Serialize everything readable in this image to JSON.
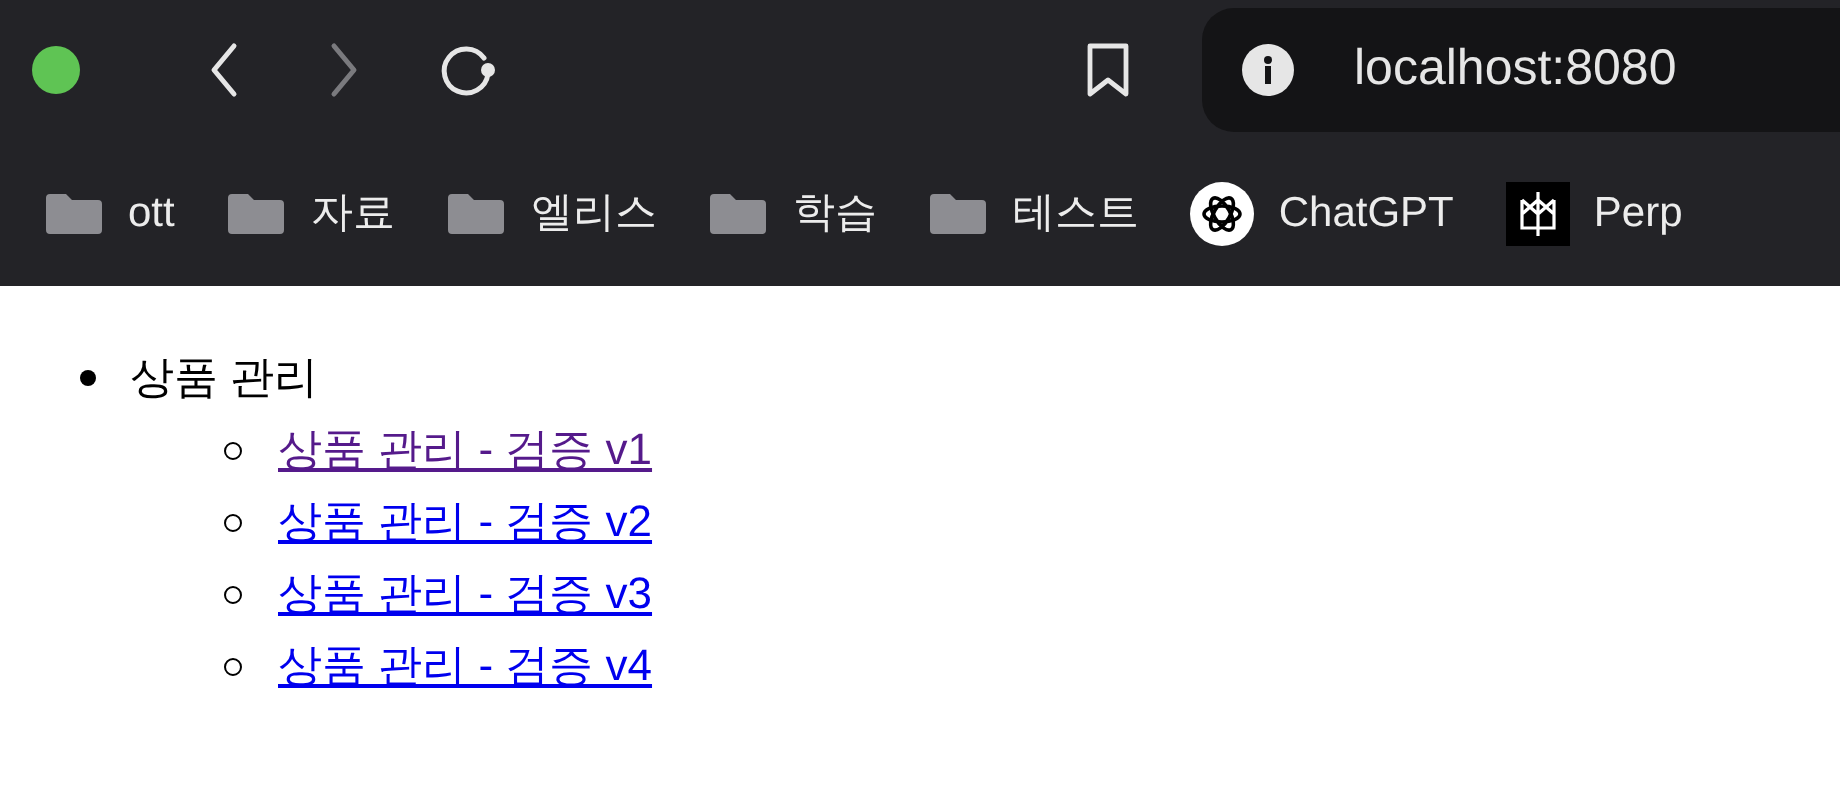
{
  "browser": {
    "address": "localhost:8080",
    "bookmarks": [
      {
        "kind": "folder",
        "label": "ott"
      },
      {
        "kind": "folder",
        "label": "자료"
      },
      {
        "kind": "folder",
        "label": "엘리스"
      },
      {
        "kind": "folder",
        "label": "학습"
      },
      {
        "kind": "folder",
        "label": "테스트"
      },
      {
        "kind": "round-logo",
        "label": "ChatGPT"
      },
      {
        "kind": "square-logo",
        "label": "Perp"
      }
    ]
  },
  "page": {
    "list": [
      {
        "label": "상품 관리",
        "children": [
          {
            "label": "상품 관리 - 검증 v1",
            "visited": true
          },
          {
            "label": "상품 관리 - 검증 v2",
            "visited": false
          },
          {
            "label": "상품 관리 - 검증 v3",
            "visited": false
          },
          {
            "label": "상품 관리 - 검증 v4",
            "visited": false
          }
        ]
      }
    ]
  }
}
